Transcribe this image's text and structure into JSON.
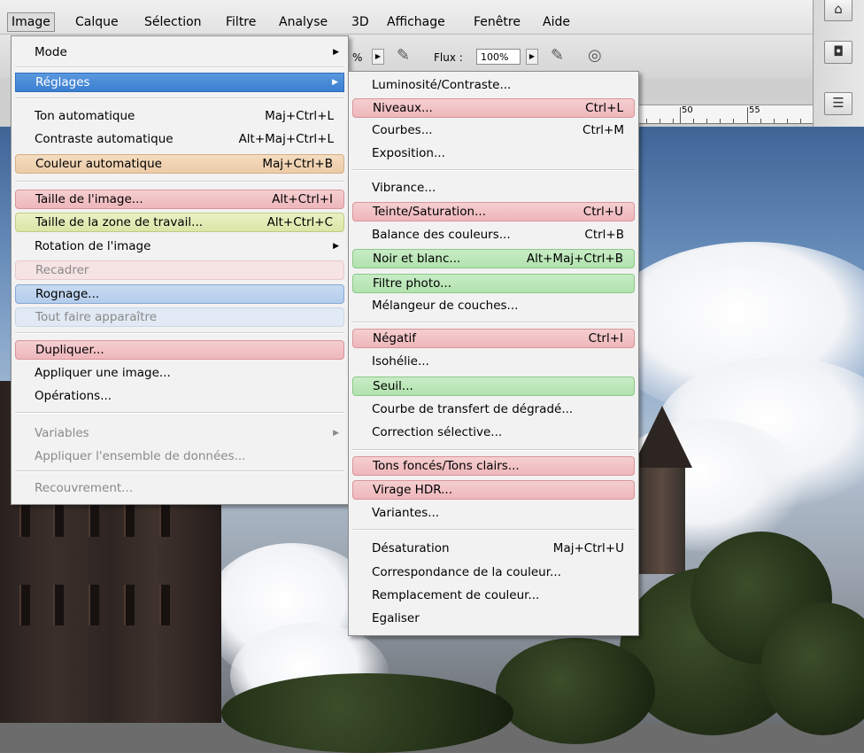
{
  "menubar": {
    "items": [
      "Image",
      "Calque",
      "Sélection",
      "Filtre",
      "Analyse",
      "3D",
      "Affichage",
      "Fenêtre",
      "Aide"
    ]
  },
  "options": {
    "percent_label": "%",
    "flux_label": "Flux :",
    "flux_value": "100%"
  },
  "ruler": {
    "n50": "50",
    "n55": "55"
  },
  "image_menu": {
    "items": {
      "mode": "Mode",
      "reglages": "Réglages",
      "ton_auto": "Ton automatique",
      "ton_auto_sc": "Maj+Ctrl+L",
      "contraste_auto": "Contraste automatique",
      "contraste_auto_sc": "Alt+Maj+Ctrl+L",
      "couleur_auto": "Couleur automatique",
      "couleur_auto_sc": "Maj+Ctrl+B",
      "taille_image": "Taille de l'image...",
      "taille_image_sc": "Alt+Ctrl+I",
      "taille_zone": "Taille de la zone de travail...",
      "taille_zone_sc": "Alt+Ctrl+C",
      "rotation": "Rotation de l'image",
      "recadrer": "Recadrer",
      "rognage": "Rognage...",
      "tout_faire": "Tout faire apparaître",
      "dupliquer": "Dupliquer...",
      "appliquer_image": "Appliquer une image...",
      "operations": "Opérations...",
      "variables": "Variables",
      "appliquer_ensemble": "Appliquer l'ensemble de données...",
      "recouvrement": "Recouvrement..."
    }
  },
  "reglages_menu": {
    "items": {
      "luminosite": "Luminosité/Contraste...",
      "niveaux": "Niveaux...",
      "niveaux_sc": "Ctrl+L",
      "courbes": "Courbes...",
      "courbes_sc": "Ctrl+M",
      "exposition": "Exposition...",
      "vibrance": "Vibrance...",
      "teinte": "Teinte/Saturation...",
      "teinte_sc": "Ctrl+U",
      "balance": "Balance des couleurs...",
      "balance_sc": "Ctrl+B",
      "noir_blanc": "Noir et blanc...",
      "noir_blanc_sc": "Alt+Maj+Ctrl+B",
      "filtre_photo": "Filtre photo...",
      "melangeur": "Mélangeur de couches...",
      "negatif": "Négatif",
      "negatif_sc": "Ctrl+I",
      "isohelie": "Isohélie...",
      "seuil": "Seuil...",
      "courbe_transfert": "Courbe de transfert de dégradé...",
      "correction": "Correction sélective...",
      "tons_fonces": "Tons foncés/Tons clairs...",
      "virage_hdr": "Virage HDR...",
      "variantes": "Variantes...",
      "desaturation": "Désaturation",
      "desaturation_sc": "Maj+Ctrl+U",
      "correspondance": "Correspondance de la couleur...",
      "remplacement": "Remplacement de couleur...",
      "egaliser": "Egaliser"
    }
  },
  "icons": {
    "submenu_arrow": "▶",
    "brush": "brush-icon",
    "airbrush": "airbrush-icon"
  },
  "colors": {
    "selection_blue": "#3a7fd0",
    "highlight_red": "#eeb6ba",
    "highlight_green": "#b2e2ae",
    "highlight_orange": "#ebcba7",
    "highlight_yellow": "#dbe5a7",
    "highlight_blue": "#b4cdec"
  }
}
